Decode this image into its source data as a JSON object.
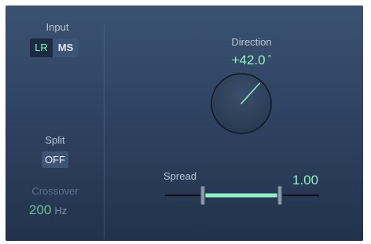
{
  "input": {
    "label": "Input",
    "options": [
      "LR",
      "MS"
    ],
    "selected": "LR"
  },
  "split": {
    "label": "Split",
    "value": "OFF"
  },
  "crossover": {
    "label": "Crossover",
    "value": "200",
    "unit": "Hz"
  },
  "direction": {
    "label": "Direction",
    "value": "+42.0",
    "unit": "°",
    "degrees": 42.0
  },
  "spread": {
    "label": "Spread",
    "value": "1.00",
    "amount": 1.0
  },
  "colors": {
    "accent": "#8ff0c3",
    "panel": "#2f4462",
    "text": "#b8c6d8"
  }
}
